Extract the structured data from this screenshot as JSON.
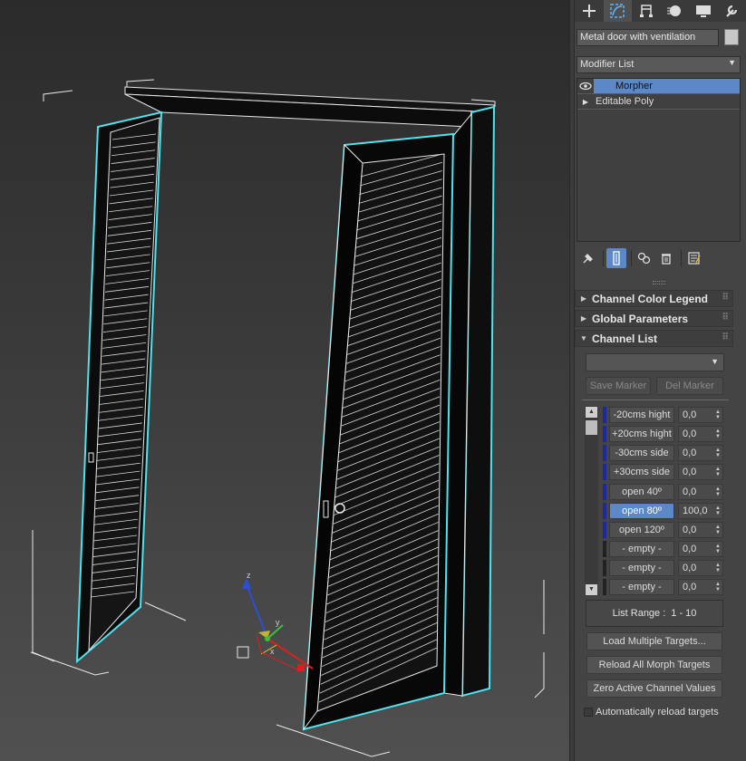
{
  "tabs": [
    {
      "name": "create-tab",
      "icon": "plus-icon",
      "active": false
    },
    {
      "name": "modify-tab",
      "icon": "modify-curve-icon",
      "active": true
    },
    {
      "name": "hierarchy-tab",
      "icon": "hierarchy-icon",
      "active": false
    },
    {
      "name": "motion-tab",
      "icon": "motion-sphere-icon",
      "active": false
    },
    {
      "name": "display-tab",
      "icon": "display-monitor-icon",
      "active": false
    },
    {
      "name": "utilities-tab",
      "icon": "wrench-icon",
      "active": false
    }
  ],
  "object": {
    "name": "Metal door with ventilation",
    "color": "#c8c8c8"
  },
  "modifier_list": {
    "label": "Modifier List"
  },
  "stack": [
    {
      "label": "Morpher",
      "selected": true
    },
    {
      "label": "Editable Poly",
      "selected": false
    }
  ],
  "rollouts": {
    "legend": "Channel Color Legend",
    "global": "Global Parameters",
    "channel_list": "Channel List"
  },
  "markers": {
    "save": "Save Marker",
    "delete": "Del Marker"
  },
  "channels": [
    {
      "name": "-20cms hight",
      "value": "0,0",
      "empty": false,
      "selected": false
    },
    {
      "name": "+20cms hight",
      "value": "0,0",
      "empty": false,
      "selected": false
    },
    {
      "name": "-30cms side",
      "value": "0,0",
      "empty": false,
      "selected": false
    },
    {
      "name": "+30cms side",
      "value": "0,0",
      "empty": false,
      "selected": false
    },
    {
      "name": "open 40º",
      "value": "0,0",
      "empty": false,
      "selected": false
    },
    {
      "name": "open 80º",
      "value": "100,0",
      "empty": false,
      "selected": true
    },
    {
      "name": "open 120º",
      "value": "0,0",
      "empty": false,
      "selected": false
    },
    {
      "name": "- empty -",
      "value": "0,0",
      "empty": true,
      "selected": false
    },
    {
      "name": "- empty -",
      "value": "0,0",
      "empty": true,
      "selected": false
    },
    {
      "name": "- empty -",
      "value": "0,0",
      "empty": true,
      "selected": false
    }
  ],
  "list_range": {
    "label": "List Range :",
    "value": "1 - 10"
  },
  "buttons": {
    "load_multiple": "Load Multiple Targets...",
    "reload_all": "Reload All Morph Targets",
    "zero_active": "Zero Active Channel Values"
  },
  "auto_reload": {
    "label": "Automatically reload targets",
    "checked": false
  },
  "gizmo": {
    "x": "x",
    "y": "y",
    "z": "z"
  },
  "colors": {
    "selection_blue": "#5c88c7",
    "wire_cyan": "#4fe3ee",
    "channel_bar": "#1a2a9c"
  }
}
